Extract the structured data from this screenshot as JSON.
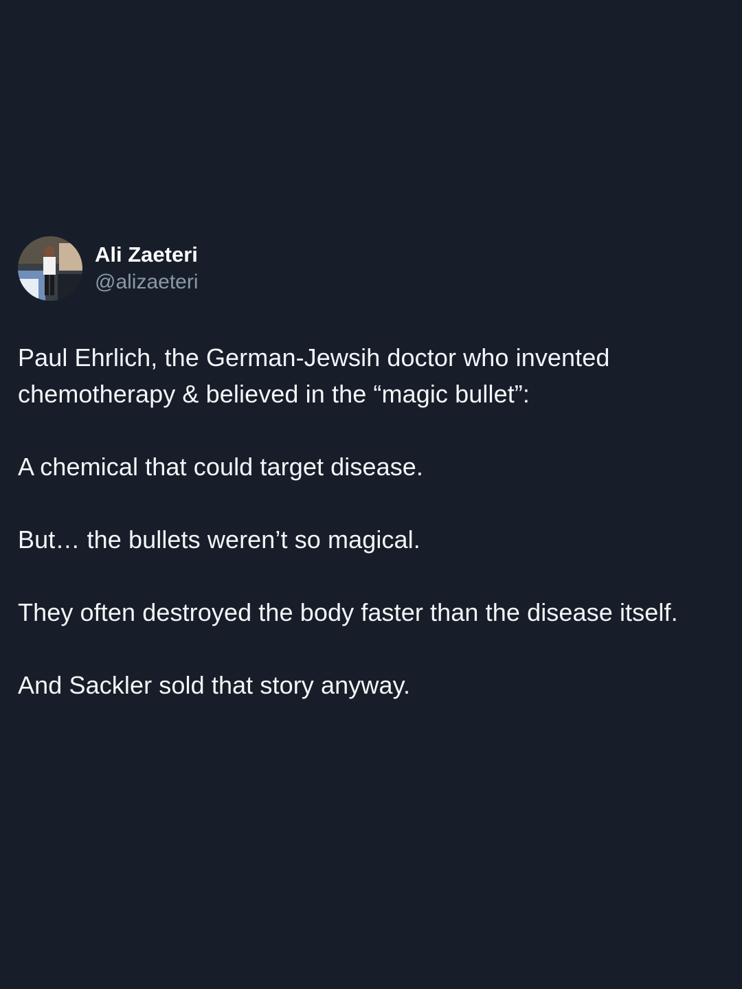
{
  "author": {
    "name": "Ali Zaeteri",
    "handle": "@alizaeteri",
    "avatar_icon": "profile-photo"
  },
  "tweet": {
    "paragraphs": [
      "Paul Ehrlich, the German-Jewsih doctor who invented chemotherapy & believed in the “magic bullet”:",
      "A chemical that could target disease.",
      "But… the bullets weren’t so magical.",
      "They often destroyed the body faster than the disease itself.",
      "And Sackler sold that story anyway."
    ]
  },
  "colors": {
    "background": "#171e2a",
    "text": "#f4f6f8",
    "secondary_text": "#8b98a5"
  }
}
